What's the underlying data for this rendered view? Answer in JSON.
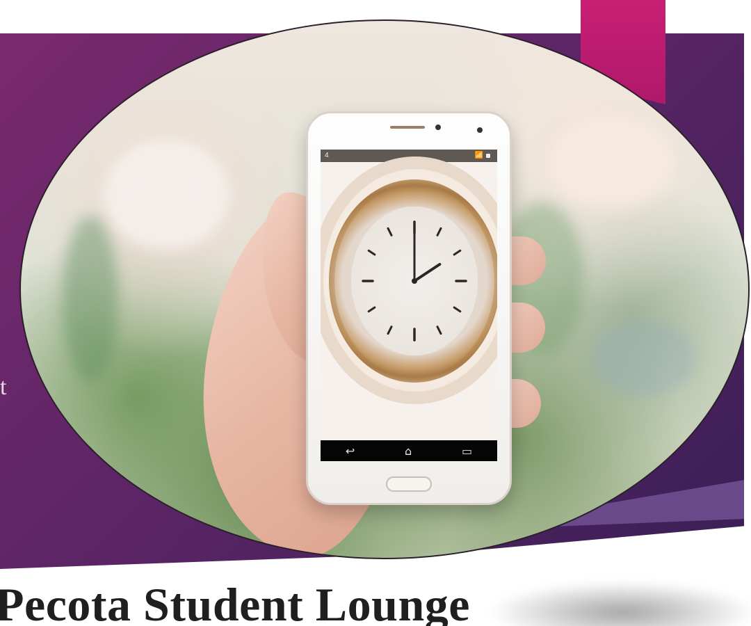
{
  "poster": {
    "title": "Pecota Student Lounge",
    "left_fragment": "t"
  },
  "phone": {
    "status_left": "4 ",
    "status_right": "",
    "clock": {
      "hour_hand_angle_deg": 60,
      "minute_hand_angle_deg": 0
    },
    "nav": {
      "back_icon": "back-icon",
      "home_icon": "home-icon",
      "recent_icon": "recent-apps-icon"
    }
  },
  "colors": {
    "purple_primary": "#5d2566",
    "magenta_tab": "#c81f74",
    "title_text": "#1f1f1f"
  }
}
